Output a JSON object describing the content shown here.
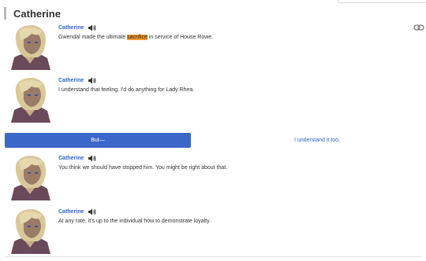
{
  "header": {
    "title": "Catherine"
  },
  "icons": {
    "link": "link-icon",
    "sound": "speaker-icon",
    "avatar": "character-portrait"
  },
  "colors": {
    "speaker": "#2f63c8",
    "highlight": "#f49a2e",
    "choice_selected": "#3b67c9"
  },
  "entries": [
    {
      "speaker": "Catherine",
      "pre": "Gwendal made the ultimate ",
      "highlight": "sacrifice",
      "post": " in service of House Rowe."
    },
    {
      "speaker": "Catherine",
      "text": "I understand that feeling. I'd do anything for Lady Rhea."
    },
    {
      "speaker": "Catherine",
      "text": "You think we should have stopped him. You might be right about that."
    },
    {
      "speaker": "Catherine",
      "text": "At any rate, it's up to the individual how to demonstrate loyalty."
    }
  ],
  "choices": [
    {
      "label": "But—",
      "selected": true
    },
    {
      "label": "I understand it too.",
      "selected": false
    }
  ]
}
